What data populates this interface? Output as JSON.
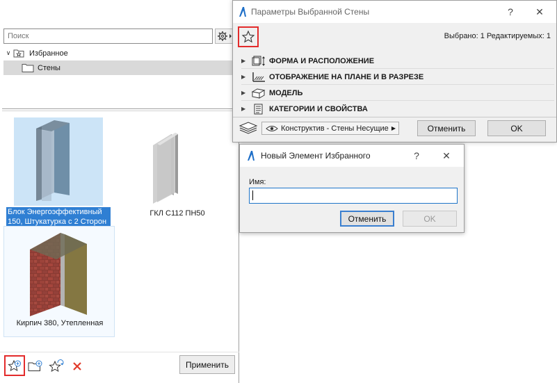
{
  "favorites": {
    "search": {
      "placeholder": "Поиск"
    },
    "tree": [
      {
        "label": "Избранное",
        "expanded": true,
        "icon": "star-folder-icon"
      },
      {
        "label": "Стены",
        "icon": "folder-icon",
        "selected": true
      }
    ],
    "items": [
      {
        "label": "Блок Энергоэффективный 150, Штукатурка с 2 Сторон",
        "selected": true
      },
      {
        "label": "ГКЛ С112 ПН50",
        "selected": false
      },
      {
        "label": "Кирпич 380, Утепленная",
        "selected": false
      }
    ],
    "tools": [
      "new-favorite-icon",
      "new-folder-icon",
      "redefine-favorite-icon",
      "delete-icon"
    ],
    "apply_label": "Применить"
  },
  "wall_dialog": {
    "title": "Параметры Выбранной Стены",
    "help": "?",
    "close": "✕",
    "selected_info": "Выбрано: 1 Редактируемых: 1",
    "sections": [
      {
        "label": "ФОРМА И РАСПОЛОЖЕНИЕ",
        "icon": "geometry-icon"
      },
      {
        "label": "ОТОБРАЖЕНИЕ НА ПЛАНЕ И В РАЗРЕЗЕ",
        "icon": "floorplan-icon"
      },
      {
        "label": "МОДЕЛЬ",
        "icon": "model-icon"
      },
      {
        "label": "КАТЕГОРИИ И СВОЙСТВА",
        "icon": "categories-icon"
      }
    ],
    "view_option": "Конструктив - Стены Несущие",
    "cancel_label": "Отменить",
    "ok_label": "OK"
  },
  "new_fav_dialog": {
    "title": "Новый Элемент Избранного",
    "help": "?",
    "close": "✕",
    "name_label": "Имя:",
    "name_value": "",
    "cancel_label": "Отменить",
    "ok_label": "OK"
  },
  "colors": {
    "highlight": "#e32b2b",
    "selection": "#2f7fd3",
    "thumb_selected_bg": "#cce4f7"
  }
}
